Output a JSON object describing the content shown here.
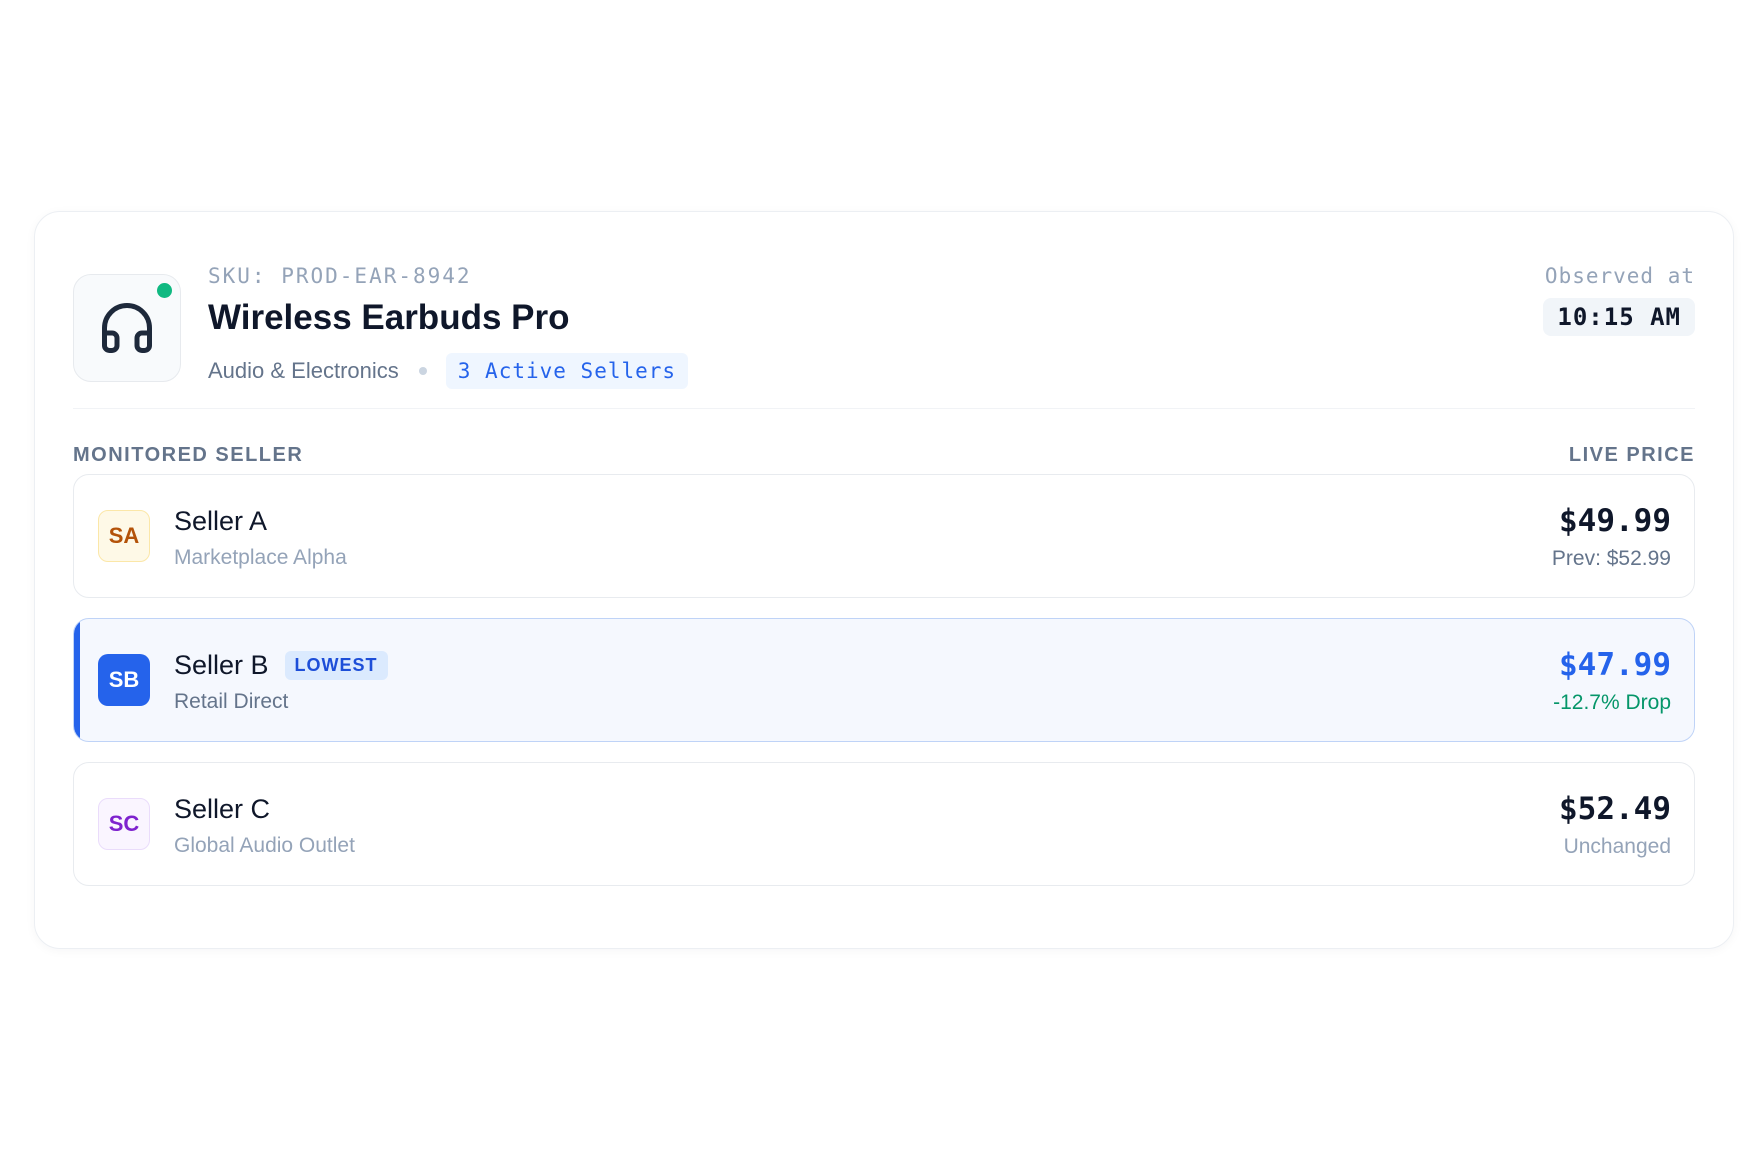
{
  "product": {
    "sku": "SKU: PROD-EAR-8942",
    "title": "Wireless Earbuds Pro",
    "category": "Audio & Electronics",
    "sellers_badge": "3 Active Sellers",
    "icon": "headphones-icon",
    "status": "online"
  },
  "observed": {
    "label": "Observed at",
    "time": "10:15 AM"
  },
  "columns": {
    "seller": "MONITORED SELLER",
    "price": "LIVE PRICE"
  },
  "sellers": [
    {
      "initials": "SA",
      "name": "Seller A",
      "market": "Marketplace Alpha",
      "price": "$49.99",
      "note": "Prev: $52.99",
      "badge": ""
    },
    {
      "initials": "SB",
      "name": "Seller B",
      "market": "Retail Direct",
      "price": "$47.99",
      "note": "-12.7% Drop",
      "badge": "LOWEST"
    },
    {
      "initials": "SC",
      "name": "Seller C",
      "market": "Global Audio Outlet",
      "price": "$52.49",
      "note": "Unchanged",
      "badge": ""
    }
  ],
  "colors": {
    "accent": "#2563eb",
    "success": "#10b981",
    "drop": "#059669"
  }
}
